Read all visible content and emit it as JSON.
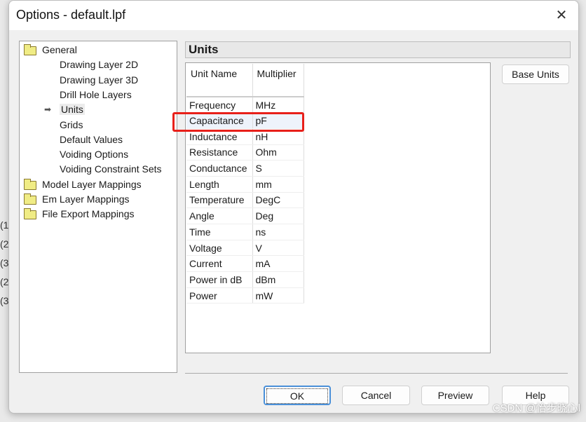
{
  "window": {
    "title": "Options - default.lpf",
    "close_icon": "close-icon"
  },
  "tree": {
    "items": [
      {
        "label": "General",
        "icon": "folder-icon",
        "level": 0
      },
      {
        "label": "Drawing Layer 2D",
        "level": 1
      },
      {
        "label": "Drawing Layer 3D",
        "level": 1
      },
      {
        "label": "Drill Hole Layers",
        "level": 1
      },
      {
        "label": "Units",
        "level": 1,
        "selected": true,
        "icon": "arrow-right-icon"
      },
      {
        "label": "Grids",
        "level": 1
      },
      {
        "label": "Default Values",
        "level": 1
      },
      {
        "label": "Voiding Options",
        "level": 1
      },
      {
        "label": "Voiding Constraint Sets",
        "level": 1
      },
      {
        "label": "Model Layer Mappings",
        "icon": "folder-icon",
        "level": 0
      },
      {
        "label": "Em Layer Mappings",
        "icon": "folder-icon",
        "level": 0
      },
      {
        "label": "File Export Mappings",
        "icon": "folder-icon",
        "level": 0
      }
    ]
  },
  "panel": {
    "title": "Units",
    "base_units_label": "Base Units"
  },
  "table": {
    "columns": [
      "Unit Name",
      "Multiplier"
    ],
    "rows": [
      [
        "Frequency",
        "MHz"
      ],
      [
        "Capacitance",
        "pF"
      ],
      [
        "Inductance",
        "nH"
      ],
      [
        "Resistance",
        "Ohm"
      ],
      [
        "Conductance",
        "S"
      ],
      [
        "Length",
        "mm"
      ],
      [
        "Temperature",
        "DegC"
      ],
      [
        "Angle",
        "Deg"
      ],
      [
        "Time",
        "ns"
      ],
      [
        "Voltage",
        "V"
      ],
      [
        "Current",
        "mA"
      ],
      [
        "Power in dB",
        "dBm"
      ],
      [
        "Power",
        "mW"
      ]
    ],
    "highlighted_row": "Capacitance",
    "highlight_color": "#e8201a"
  },
  "buttons": {
    "ok": "OK",
    "cancel": "Cancel",
    "preview": "Preview",
    "help": "Help"
  },
  "watermark": "CSDN @怡步晓心l"
}
